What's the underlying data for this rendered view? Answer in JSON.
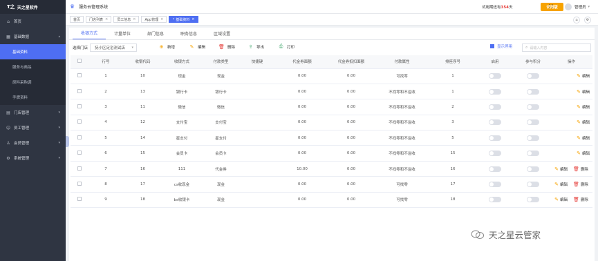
{
  "brand": {
    "logo": "T之",
    "name": "天之星软件"
  },
  "sidebar": {
    "items": [
      {
        "label": "首页",
        "icon": "home-icon",
        "expanded": false
      },
      {
        "label": "基础数据",
        "icon": "grid-icon",
        "expanded": true,
        "children": [
          {
            "label": "基础资料",
            "active": true
          },
          {
            "label": "服务与商品",
            "active": false
          },
          {
            "label": "原料采购调",
            "active": false
          },
          {
            "label": "手牌资料",
            "active": false
          }
        ]
      },
      {
        "label": "门店管理",
        "icon": "store-icon",
        "expanded": false
      },
      {
        "label": "员工管理",
        "icon": "user-icon",
        "expanded": false
      },
      {
        "label": "会员管理",
        "icon": "member-icon",
        "expanded": false
      },
      {
        "label": "系统管理",
        "icon": "settings-icon",
        "expanded": false
      }
    ]
  },
  "topbar": {
    "app_name": "服务云管理系统",
    "trial_prefix": "试用期还有",
    "trial_days": "354",
    "trial_suffix": "天",
    "trial_button": "试用版",
    "user": "管理员"
  },
  "tags": [
    {
      "label": "首页",
      "closable": false,
      "active": false
    },
    {
      "label": "门店列表",
      "closable": true,
      "active": false
    },
    {
      "label": "员工信息",
      "closable": true,
      "active": false
    },
    {
      "label": "App管理",
      "closable": true,
      "active": false
    },
    {
      "label": "基础资料",
      "closable": true,
      "active": true
    }
  ],
  "subtabs": [
    {
      "label": "收银方式",
      "active": true
    },
    {
      "label": "计量单位",
      "active": false
    },
    {
      "label": "部门信息",
      "active": false
    },
    {
      "label": "职务信息",
      "active": false
    },
    {
      "label": "区域设置",
      "active": false
    }
  ],
  "toolbar": {
    "store_label": "选择门店",
    "store_value": "抚小区足浴测试店",
    "add": "新增",
    "edit": "编辑",
    "delete": "删除",
    "export": "导出",
    "print": "打印",
    "show_disabled": "显示停用",
    "search_placeholder": "请输入内容"
  },
  "table": {
    "headers": [
      "行号",
      "收银代码",
      "收银方式",
      "付款类型",
      "快捷键",
      "代金券面额",
      "代金券抵扣面额",
      "付款属性",
      "排座序号",
      "启用",
      "参与积分",
      "操作"
    ],
    "rows": [
      {
        "row": "1",
        "code": "10",
        "method": "现金",
        "pay_type": "现金",
        "hotkey": "",
        "face": "0.00",
        "deduct": "0.00",
        "attr": "可找零",
        "order": "1",
        "deletable": false
      },
      {
        "row": "2",
        "code": "13",
        "method": "银行卡",
        "pay_type": "银行卡",
        "hotkey": "",
        "face": "0.00",
        "deduct": "0.00",
        "attr": "不找零和不溢收",
        "order": "1",
        "deletable": false
      },
      {
        "row": "3",
        "code": "11",
        "method": "微信",
        "pay_type": "微信",
        "hotkey": "",
        "face": "0.00",
        "deduct": "0.00",
        "attr": "不找零和不溢收",
        "order": "2",
        "deletable": false
      },
      {
        "row": "4",
        "code": "12",
        "method": "支付宝",
        "pay_type": "支付宝",
        "hotkey": "",
        "face": "0.00",
        "deduct": "0.00",
        "attr": "不找零和不溢收",
        "order": "3",
        "deletable": false
      },
      {
        "row": "5",
        "code": "14",
        "method": "星支付",
        "pay_type": "星支付",
        "hotkey": "",
        "face": "0.00",
        "deduct": "0.00",
        "attr": "不找零和不溢收",
        "order": "5",
        "deletable": false
      },
      {
        "row": "6",
        "code": "15",
        "method": "会员卡",
        "pay_type": "会员卡",
        "hotkey": "",
        "face": "0.00",
        "deduct": "0.00",
        "attr": "不找零和不溢收",
        "order": "15",
        "deletable": false
      },
      {
        "row": "7",
        "code": "16",
        "method": "111",
        "pay_type": "代金券",
        "hotkey": "",
        "face": "10.00",
        "deduct": "0.00",
        "attr": "不找零和不溢收",
        "order": "16",
        "deletable": true
      },
      {
        "row": "8",
        "code": "17",
        "method": "cs收现金",
        "pay_type": "现金",
        "hotkey": "",
        "face": "0.00",
        "deduct": "0.00",
        "attr": "可找零",
        "order": "17",
        "deletable": true
      },
      {
        "row": "9",
        "code": "18",
        "method": "bs收银卡",
        "pay_type": "现金",
        "hotkey": "",
        "face": "0.00",
        "deduct": "0.00",
        "attr": "可找零",
        "order": "18",
        "deletable": true
      }
    ],
    "edit_label": "编辑",
    "delete_label": "删除"
  },
  "watermark": "天之星云管家",
  "colors": {
    "primary": "#4e6ef2",
    "sidebar": "#2f3542",
    "warning": "#f7a300",
    "danger": "#e53935"
  }
}
